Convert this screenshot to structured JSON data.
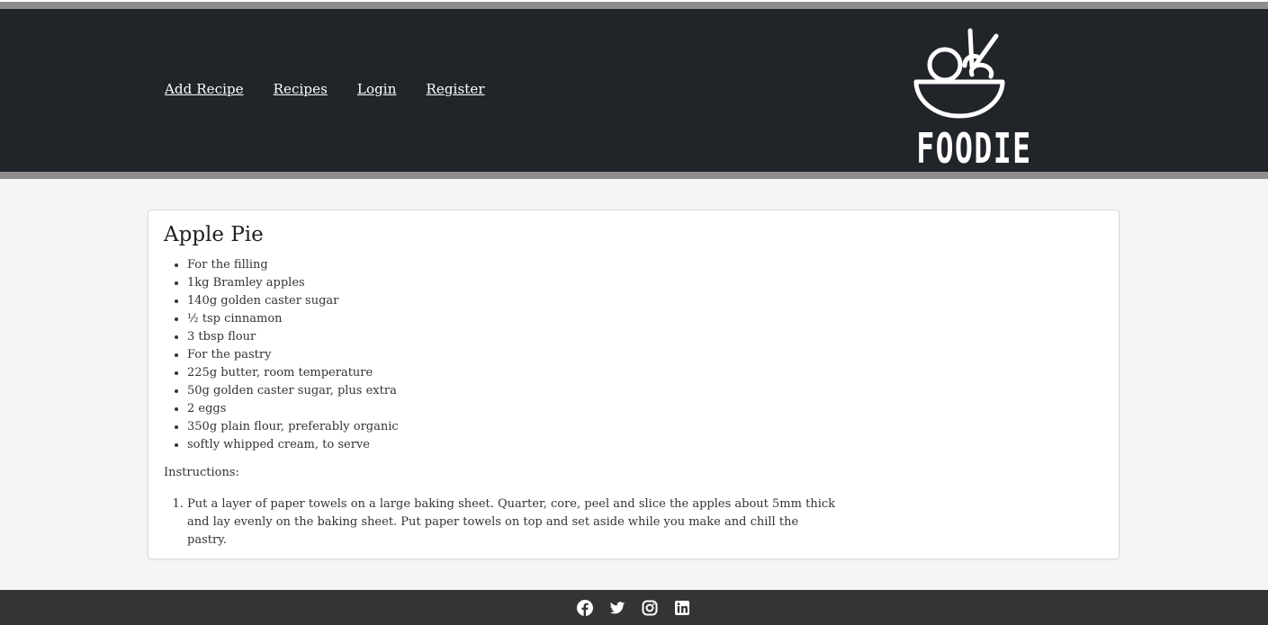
{
  "nav": {
    "items": [
      {
        "label": "Add Recipe"
      },
      {
        "label": "Recipes"
      },
      {
        "label": "Login"
      },
      {
        "label": "Register"
      }
    ]
  },
  "brand": {
    "logo_text": "FOODIE",
    "logo_icon": "bowl-chopsticks-icon"
  },
  "recipe": {
    "title": "Apple Pie",
    "ingredients": [
      "For the filling",
      "1kg Bramley apples",
      "140g golden caster sugar",
      "½ tsp cinnamon",
      "3 tbsp flour",
      "For the pastry",
      "225g butter, room temperature",
      "50g golden caster sugar, plus extra",
      "2 eggs",
      "350g plain flour, preferably organic",
      "softly whipped cream, to serve"
    ],
    "instructions_label": "Instructions:",
    "steps": [
      "Put a layer of paper towels on a large baking sheet. Quarter, core, peel and slice the apples about 5mm thick and lay evenly on the baking sheet. Put paper towels on top and set aside while you make and chill the pastry."
    ]
  },
  "footer": {
    "social": [
      "facebook-icon",
      "twitter-icon",
      "instagram-icon",
      "linkedin-icon"
    ]
  },
  "colors": {
    "header_bg": "#212529",
    "stripe": "#8f8c8d",
    "page_bg": "#f5f5f5",
    "footer_bg": "#343434"
  }
}
